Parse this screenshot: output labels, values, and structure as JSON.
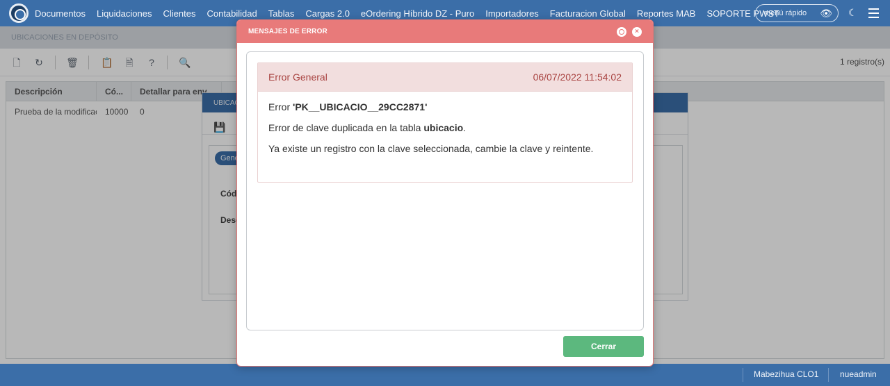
{
  "topbar": {
    "nav": [
      "Documentos",
      "Liquidaciones",
      "Clientes",
      "Contabilidad",
      "Tablas",
      "Cargas 2.0",
      "eOrdering Híbrido DZ - Puro",
      "Importadores",
      "Facturacion Global",
      "Reportes MAB",
      "SOPORTE PWST"
    ],
    "quick_menu_label": "menú rápido"
  },
  "page": {
    "title": "UBICACIONES EN DEPÓSITO",
    "records": "1 registro(s)"
  },
  "grid": {
    "columns": [
      "Descripción",
      "Có...",
      "Detallar para env"
    ],
    "rows": [
      [
        "Prueba de la modificac",
        "10000",
        "0"
      ]
    ]
  },
  "subform": {
    "title": "UBICAC",
    "tab": "Gene",
    "label_code": "Códi",
    "label_desc": "Desc"
  },
  "status": {
    "user_location": "Mabezihua CLO1",
    "username": "nueadmin"
  },
  "modal": {
    "title": "MENSAJES DE ERROR",
    "error": {
      "heading": "Error General",
      "timestamp": "06/07/2022 11:54:02",
      "line1_prefix": "Error ",
      "line1_key": "'PK__UBICACIO__29CC2871'",
      "line2_prefix": "Error de clave duplicada en la tabla ",
      "line2_table": "ubicacio",
      "line2_suffix": ".",
      "line3": "Ya existe un registro con la clave seleccionada, cambie la clave y reintente."
    },
    "close_label": "Cerrar"
  }
}
